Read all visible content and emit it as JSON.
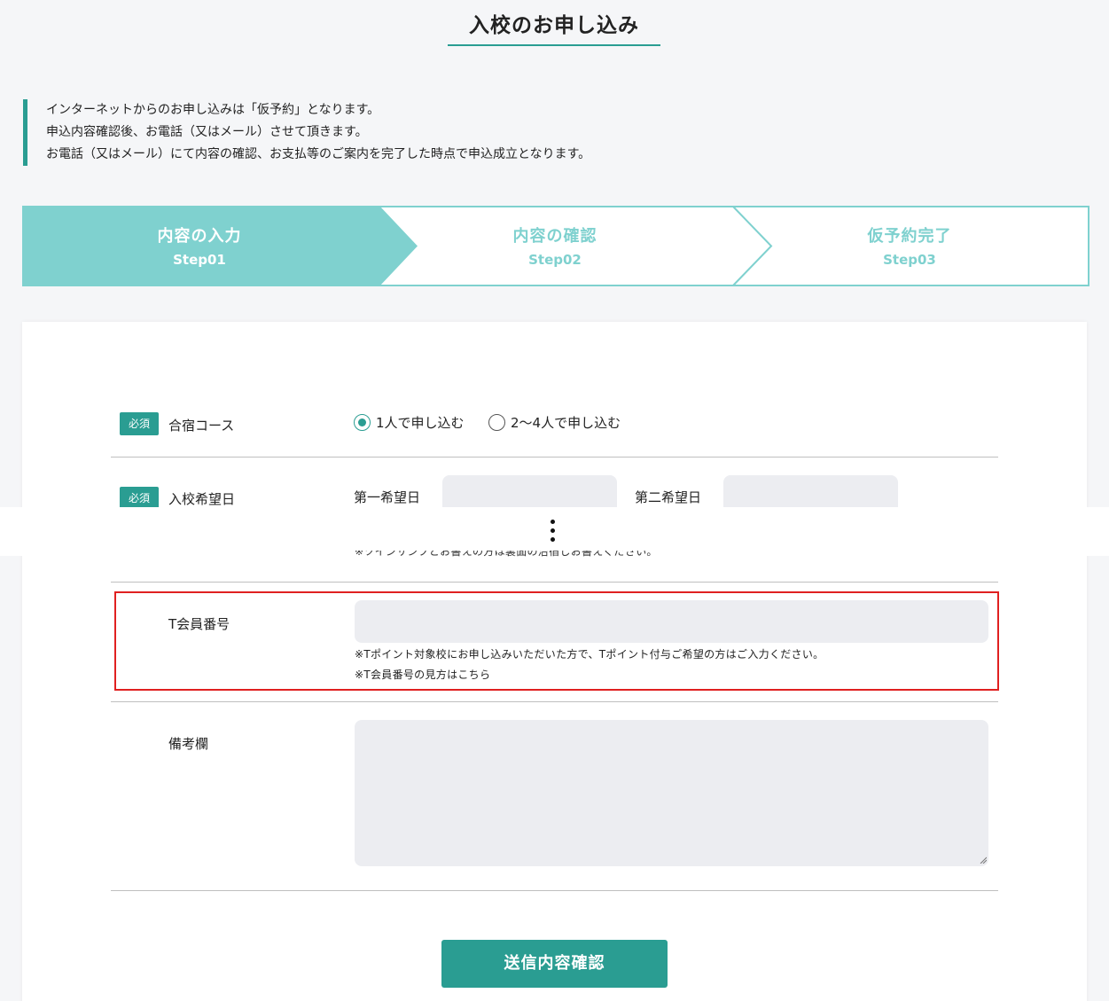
{
  "page_title": "入校のお申し込み",
  "notice": [
    "インターネットからのお申し込みは「仮予約」となります。",
    "申込内容確認後、お電話（又はメール）させて頂きます。",
    "お電話（又はメール）にて内容の確認、お支払等のご案内を完了した時点で申込成立となります。"
  ],
  "steps": [
    {
      "title": "内容の入力",
      "num": "Step01",
      "active": true
    },
    {
      "title": "内容の確認",
      "num": "Step02",
      "active": false
    },
    {
      "title": "仮予約完了",
      "num": "Step03",
      "active": false
    }
  ],
  "form": {
    "required_badge": "必須",
    "course": {
      "label": "合宿コース",
      "options": [
        "1人で申し込む",
        "2〜4人で申し込む"
      ],
      "selected_index": 0
    },
    "date": {
      "label": "入校希望日",
      "first_label": "第一希望日",
      "second_label": "第二希望日"
    },
    "partial_hint": "※ツインサンプとお書えの方は裏面の治宿しお書えください。",
    "tmember": {
      "label": "T会員番号",
      "value": "",
      "hint1": "※Tポイント対象校にお申し込みいただいた方で、Tポイント付与ご希望の方はご入力ください。",
      "hint2": "※T会員番号の見方はこちら"
    },
    "remarks": {
      "label": "備考欄",
      "value": ""
    },
    "submit_label": "送信内容確認"
  },
  "colors": {
    "accent": "#2a9d92",
    "step_active": "#7fd1cf",
    "input_bg": "#ecedf1",
    "highlight": "#e02020"
  }
}
